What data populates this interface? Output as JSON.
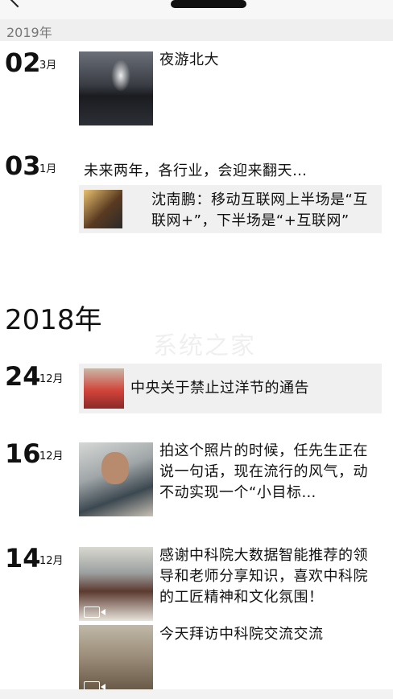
{
  "nav": {
    "back_icon": "chevron-left-icon"
  },
  "section_2019": "2019年",
  "year_2018": "2018年",
  "posts": [
    {
      "day": "02",
      "month": "3月",
      "text": "夜游北大"
    },
    {
      "day": "03",
      "month": "1月",
      "text": "未来两年，各行业，会迎来翻天…",
      "share_title": "沈南鹏：移动互联网上半场是“互联网+”，下半场是“+互联网”"
    },
    {
      "day": "24",
      "month": "12月",
      "text": "中央关于禁止过洋节的通告"
    },
    {
      "day": "16",
      "month": "12月",
      "text": "拍这个照片的时候，任先生正在说一句话，现在流行的风气，动不动实现一个“小目标…"
    },
    {
      "day": "14",
      "month": "12月",
      "text": "感谢中科院大数据智能推荐的领导和老师分享知识，喜欢中科院的工匠精神和文化氛围！",
      "text2": "今天拜访中科院交流交流"
    }
  ],
  "colors": {
    "section_bg": "#efefef",
    "card_bg": "#f0f0f0"
  }
}
